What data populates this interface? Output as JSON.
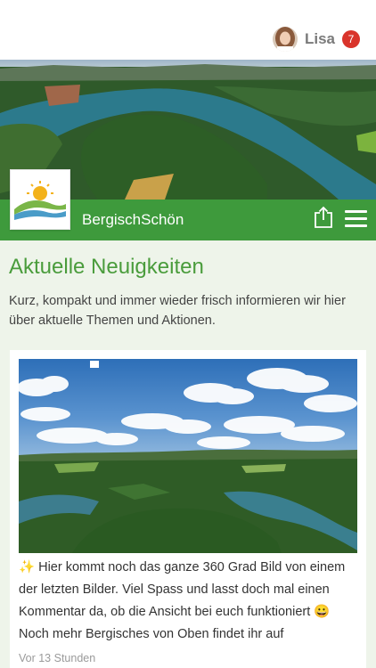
{
  "header": {
    "user_name": "Lisa",
    "notification_count": "7"
  },
  "brand": {
    "name": "BergischSchön"
  },
  "news": {
    "title": "Aktuelle Neuigkeiten",
    "intro": "Kurz, kompakt und immer wieder frisch informieren wir hier über aktuelle Themen und Aktionen."
  },
  "post": {
    "sparkle": "✨",
    "text_part1": " Hier kommt noch das ganze 360 Grad Bild von einem der letzten Bilder. Viel Spass und lasst doch mal einen Kommentar da, ob die Ansicht bei euch funktioniert ",
    "smiley": "😀",
    "text_part2": " Noch mehr Bergisches von Oben findet ihr auf",
    "time": "Vor 13 Stunden"
  },
  "colors": {
    "brand_green": "#3e9a3c",
    "title_green": "#4a9c3c",
    "badge_red": "#d9342b",
    "page_bg": "#eef4ea"
  }
}
